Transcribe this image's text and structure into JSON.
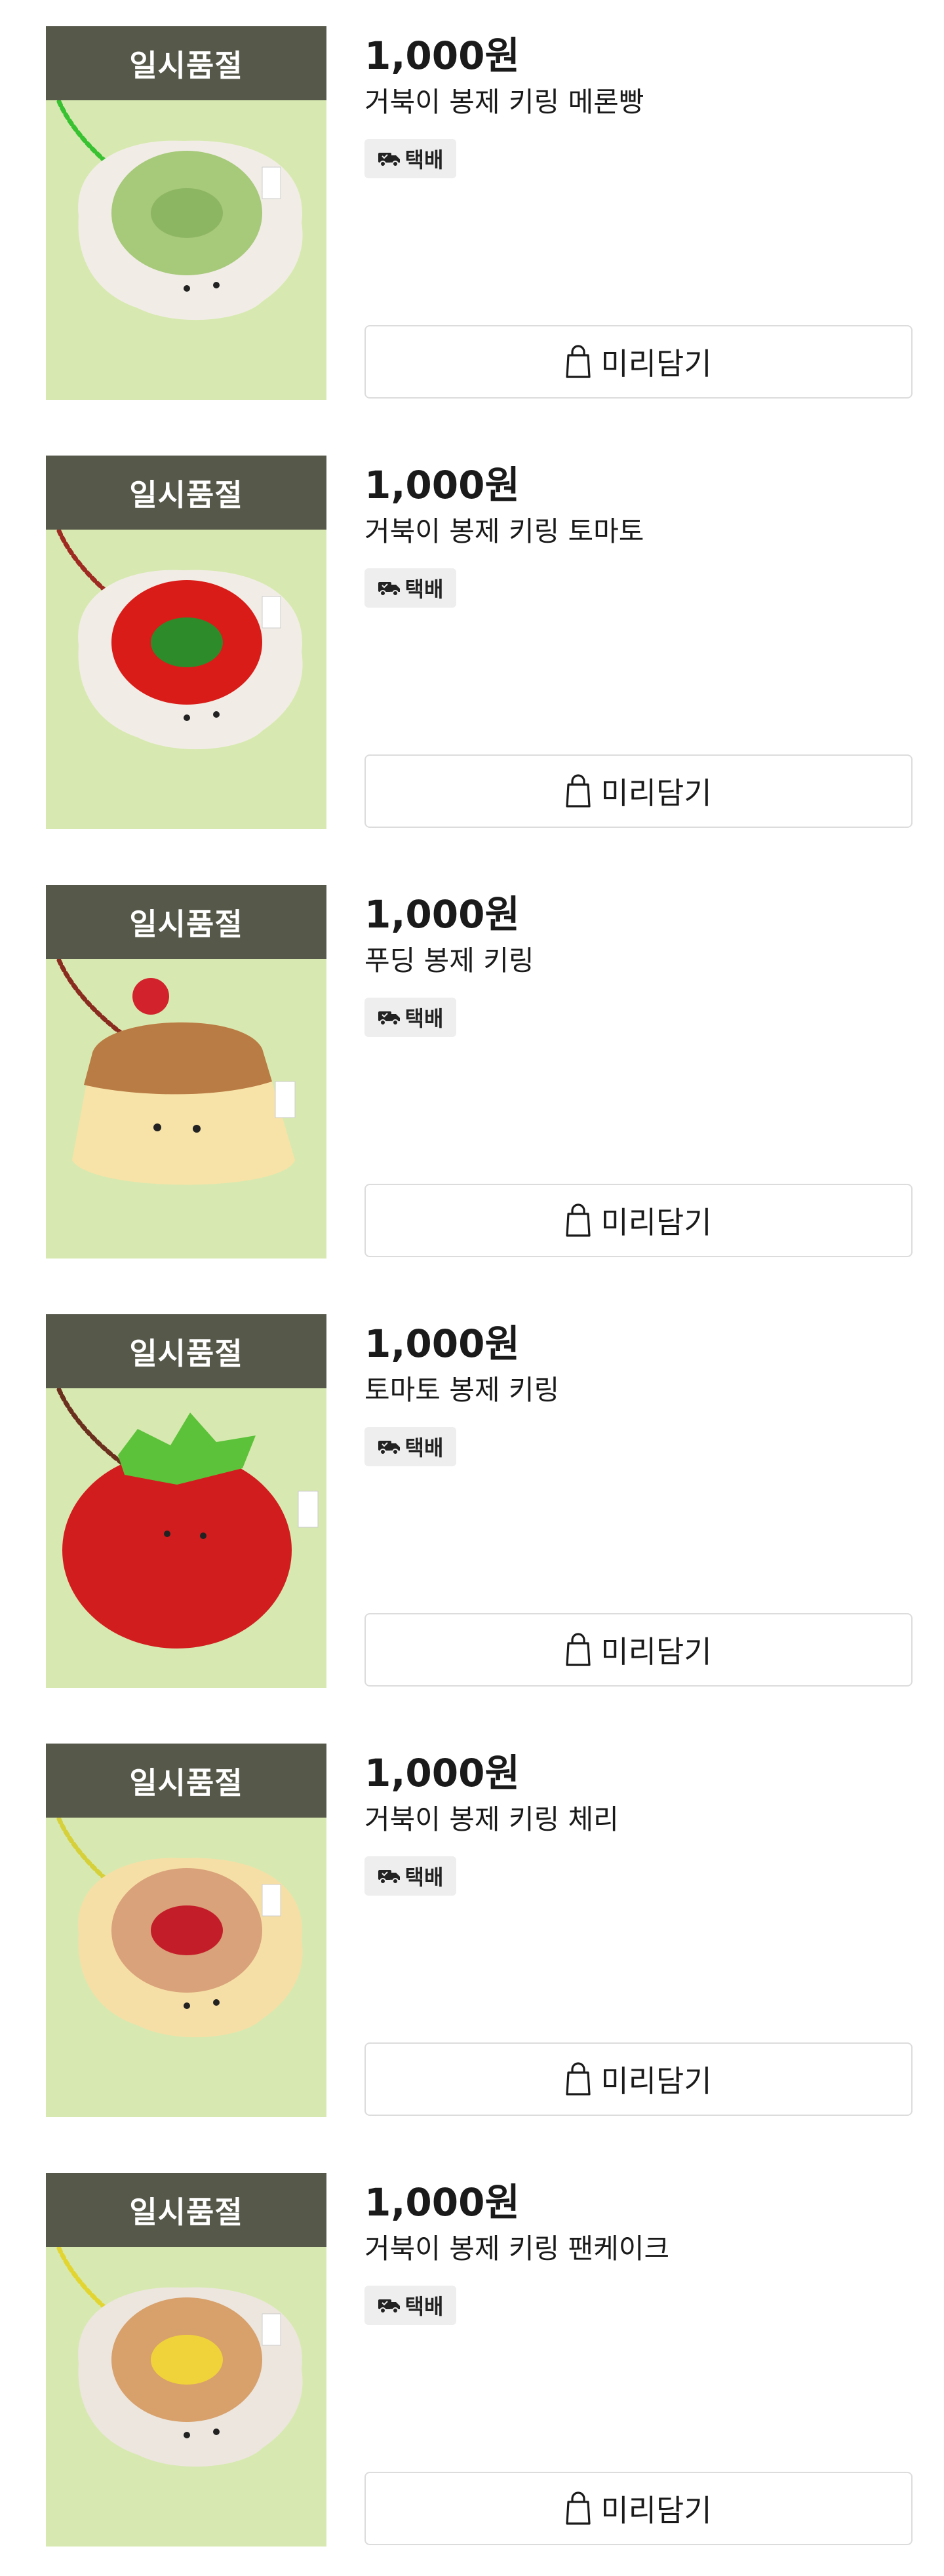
{
  "colors": {
    "badge_bg": "#56584a",
    "thumb_bg": "#d7e9b0",
    "chip_bg": "#eeeeee",
    "button_border": "#dcdcdc"
  },
  "products": [
    {
      "badge": "일시품절",
      "price": "1,000원",
      "title": "거북이 봉제 키링 메론빵",
      "delivery": "택배",
      "button": "미리담기",
      "image": {
        "shape": "turtle",
        "body": "#f1ede6",
        "shell": "#a7c97a",
        "shell_detail": "#8db663",
        "chain": "#38c130"
      }
    },
    {
      "badge": "일시품절",
      "price": "1,000원",
      "title": "거북이 봉제 키링 토마토",
      "delivery": "택배",
      "button": "미리담기",
      "image": {
        "shape": "turtle",
        "body": "#f1ede6",
        "shell": "#d91c18",
        "shell_detail": "#2e8b2a",
        "chain": "#9e2a22"
      }
    },
    {
      "badge": "일시품절",
      "price": "1,000원",
      "title": "푸딩 봉제 키링",
      "delivery": "택배",
      "button": "미리담기",
      "image": {
        "shape": "pudding",
        "body": "#f7e3a8",
        "shell": "#b97c44",
        "shell_detail": "#d2232d",
        "chain": "#8a2b20"
      }
    },
    {
      "badge": "일시품절",
      "price": "1,000원",
      "title": "토마토 봉제 키링",
      "delivery": "택배",
      "button": "미리담기",
      "image": {
        "shape": "tomato",
        "body": "#d21d1f",
        "shell": "#5cc23a",
        "shell_detail": "#5cc23a",
        "chain": "#6b2f1e"
      }
    },
    {
      "badge": "일시품절",
      "price": "1,000원",
      "title": "거북이 봉제 키링 체리",
      "delivery": "택배",
      "button": "미리담기",
      "image": {
        "shape": "turtle",
        "body": "#f6dfa6",
        "shell": "#d9a27a",
        "shell_detail": "#c41d2a",
        "chain": "#d6d03a"
      }
    },
    {
      "badge": "일시품절",
      "price": "1,000원",
      "title": "거북이 봉제 키링 팬케이크",
      "delivery": "택배",
      "button": "미리담기",
      "image": {
        "shape": "turtle",
        "body": "#ece6de",
        "shell": "#d8a06a",
        "shell_detail": "#f0d33a",
        "chain": "#e3d531"
      }
    }
  ]
}
